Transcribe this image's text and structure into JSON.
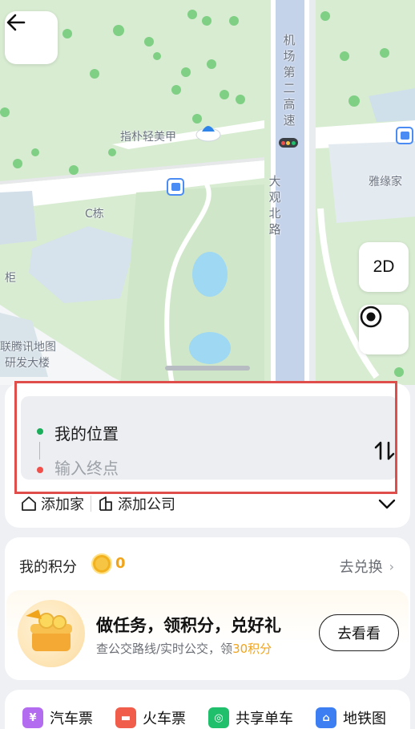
{
  "map": {
    "labels": {
      "expressway": "机场第二高速",
      "road": "大观北路",
      "poi_zhipu": "指朴轻美甲",
      "poi_yayuan": "雅缘家",
      "building_c": "C栋",
      "cabinet": "柜",
      "tencent_line1": "联腾讯地图",
      "tencent_line2": "研发大楼"
    },
    "controls": {
      "mode_label": "2D"
    },
    "icons": {
      "back": "arrow-left-icon",
      "locate": "locate-target-icon",
      "bus": "bus-stop-icon"
    }
  },
  "route": {
    "origin": "我的位置",
    "destination_placeholder": "输入终点",
    "quick": {
      "home": "添加家",
      "company": "添加公司"
    }
  },
  "points": {
    "title": "我的积分",
    "value": "0",
    "redeem_label": "去兑换",
    "task": {
      "title": "做任务，领积分，兑好礼",
      "subtitle_prefix": "查公交路线/实时公交，领",
      "subtitle_highlight": "30积分",
      "button": "去看看"
    }
  },
  "services": [
    {
      "label": "汽车票",
      "icon": "bus-ticket-icon",
      "color": "#b36cf0"
    },
    {
      "label": "火车票",
      "icon": "train-ticket-icon",
      "color": "#f05d4a"
    },
    {
      "label": "共享单车",
      "icon": "bike-icon",
      "color": "#1fbf6b"
    },
    {
      "label": "地铁图",
      "icon": "metro-icon",
      "color": "#3d7ff2"
    }
  ],
  "colors": {
    "accent_orange": "#f0a41b",
    "start_dot": "#1aad5a",
    "end_dot": "#f04f4a",
    "highlight": "#e04e4b"
  }
}
